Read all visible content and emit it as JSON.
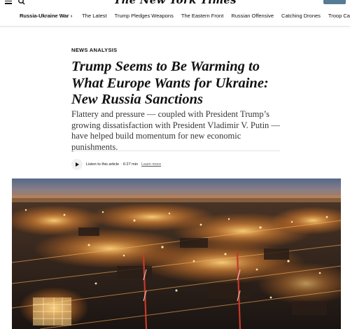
{
  "masthead": {
    "logo_text": "The New York Times",
    "menu_icon": "hamburger-menu-icon",
    "search_icon": "search-icon"
  },
  "nav": {
    "section_label": "Russia-Ukraine War",
    "section_chevron": "›",
    "items": [
      {
        "label": "The Latest"
      },
      {
        "label": "Trump Pledges Weapons"
      },
      {
        "label": "The Eastern Front"
      },
      {
        "label": "Russian Offensive"
      },
      {
        "label": "Catching Drones"
      },
      {
        "label": "Troop Casualties"
      }
    ]
  },
  "article": {
    "kicker": "NEWS ANALYSIS",
    "headline": "Trump Seems to Be Warming to What Europe Wants for Ukraine: New Russia Sanctions",
    "summary": "Flattery and pressure — coupled with President Trump’s growing dissatisfaction with President Vladimir V. Putin — have helped build momentum for new economic punishments.",
    "listen": {
      "label": "Listen to this article",
      "separator": "·",
      "duration": "6:27 min",
      "learn_more": "Learn more"
    }
  },
  "colors": {
    "text": "#121212",
    "summary_text": "#363636",
    "account_button": "#567b95",
    "divider": "#e2e2e2"
  }
}
